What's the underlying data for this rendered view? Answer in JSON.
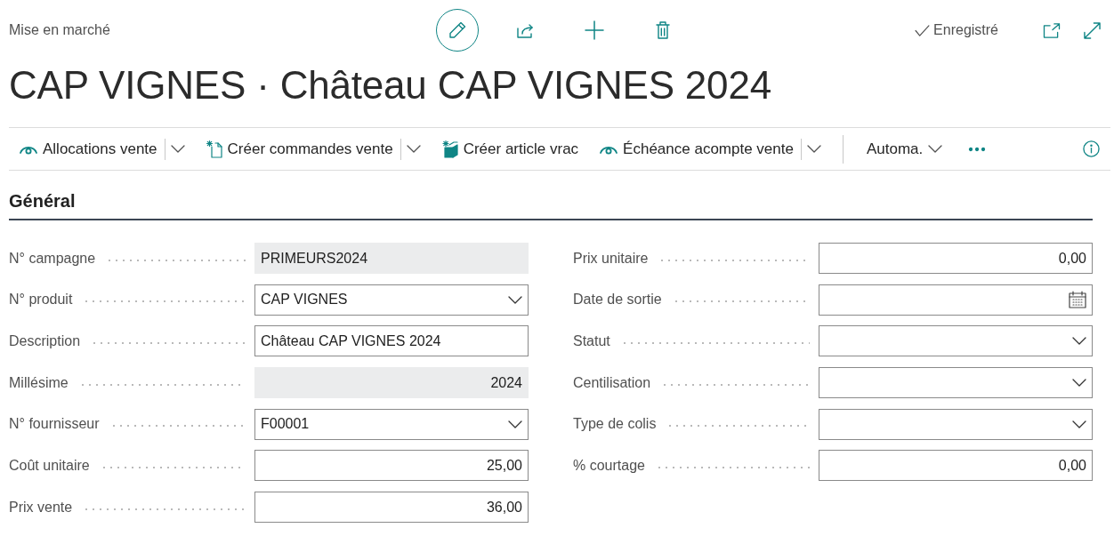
{
  "header": {
    "breadcrumb": "Mise en marché",
    "edit_mode": true,
    "save_status": "Enregistré"
  },
  "title": "CAP VIGNES · Château CAP VIGNES 2024",
  "actions": [
    {
      "label": "Allocations vente",
      "kind": "view",
      "split": true
    },
    {
      "label": "Créer commandes vente",
      "kind": "new-document",
      "split": true
    },
    {
      "label": "Créer article vrac",
      "kind": "new-item",
      "split": false
    },
    {
      "label": "Échéance acompte vente",
      "kind": "view",
      "split": true
    },
    {
      "label": "Automa.",
      "kind": "menu",
      "split": false
    }
  ],
  "section": {
    "title": "Général",
    "columns": [
      [
        {
          "label": "N° campagne",
          "value": "PRIMEURS2024",
          "kind": "text",
          "editable": false
        },
        {
          "label": "N° produit",
          "value": "CAP VIGNES",
          "kind": "select",
          "editable": true
        },
        {
          "label": "Description",
          "value": "Château CAP VIGNES 2024",
          "kind": "text",
          "editable": true
        },
        {
          "label": "Millésime",
          "value": "2024",
          "kind": "number",
          "editable": false
        },
        {
          "label": "N° fournisseur",
          "value": "F00001",
          "kind": "select",
          "editable": true
        },
        {
          "label": "Coût unitaire",
          "value": "25,00",
          "kind": "number",
          "editable": true
        },
        {
          "label": "Prix vente",
          "value": "36,00",
          "kind": "number",
          "editable": true
        }
      ],
      [
        {
          "label": "Prix unitaire",
          "value": "0,00",
          "kind": "number",
          "editable": true
        },
        {
          "label": "Date de sortie",
          "kind": "date",
          "editable": true
        },
        {
          "label": "Statut",
          "kind": "select",
          "editable": true
        },
        {
          "label": "Centilisation",
          "kind": "select",
          "editable": true
        },
        {
          "label": "Type de colis",
          "kind": "select",
          "editable": true
        },
        {
          "label": "% courtage",
          "value": "0,00",
          "kind": "number",
          "editable": true
        }
      ]
    ]
  }
}
